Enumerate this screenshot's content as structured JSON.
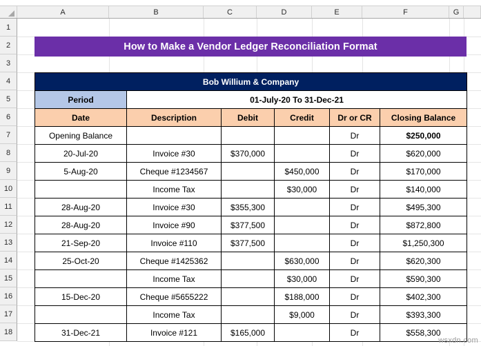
{
  "spreadsheet": {
    "column_headers": [
      "A",
      "B",
      "C",
      "D",
      "E",
      "F",
      "G"
    ],
    "row_headers": [
      "1",
      "2",
      "3",
      "4",
      "5",
      "6",
      "7",
      "8",
      "9",
      "10",
      "11",
      "12",
      "13",
      "14",
      "15",
      "16",
      "17",
      "18"
    ],
    "corner_name": "select-all-corner"
  },
  "title_banner": {
    "text": "How to Make a Vendor Ledger Reconciliation Format",
    "background": "#6B2FA8",
    "text_color": "#FFFFFF"
  },
  "ledger": {
    "company_name": "Bob Willium & Company",
    "company_header_background": "#002060",
    "period_label": "Period",
    "period_label_background": "#B4C7E7",
    "period_value": "01-July-20 To 31-Dec-21",
    "header_background": "#FBCFAD",
    "columns": [
      "Date",
      "Description",
      "Debit",
      "Credit",
      "Dr or CR",
      "Closing Balance"
    ],
    "rows": [
      {
        "date": "Opening Balance",
        "description": "",
        "debit": "",
        "credit": "",
        "dr_or_cr": "Dr",
        "closing_balance": "$250,000",
        "bold_balance": true,
        "date_bold": false
      },
      {
        "date": "20-Jul-20",
        "description": "Invoice #30",
        "debit": "$370,000",
        "credit": "",
        "dr_or_cr": "Dr",
        "closing_balance": "$620,000",
        "bold_balance": false
      },
      {
        "date": "5-Aug-20",
        "description": "Cheque #1234567",
        "debit": "",
        "credit": "$450,000",
        "dr_or_cr": "Dr",
        "closing_balance": "$170,000",
        "bold_balance": false
      },
      {
        "date": "",
        "description": "Income Tax",
        "debit": "",
        "credit": "$30,000",
        "dr_or_cr": "Dr",
        "closing_balance": "$140,000",
        "bold_balance": false
      },
      {
        "date": "28-Aug-20",
        "description": "Invoice #30",
        "debit": "$355,300",
        "credit": "",
        "dr_or_cr": "Dr",
        "closing_balance": "$495,300",
        "bold_balance": false
      },
      {
        "date": "28-Aug-20",
        "description": "Invoice #90",
        "debit": "$377,500",
        "credit": "",
        "dr_or_cr": "Dr",
        "closing_balance": "$872,800",
        "bold_balance": false
      },
      {
        "date": "21-Sep-20",
        "description": "Invoice #110",
        "debit": "$377,500",
        "credit": "",
        "dr_or_cr": "Dr",
        "closing_balance": "$1,250,300",
        "bold_balance": false
      },
      {
        "date": "25-Oct-20",
        "description": "Cheque #1425362",
        "debit": "",
        "credit": "$630,000",
        "dr_or_cr": "Dr",
        "closing_balance": "$620,300",
        "bold_balance": false
      },
      {
        "date": "",
        "description": "Income Tax",
        "debit": "",
        "credit": "$30,000",
        "dr_or_cr": "Dr",
        "closing_balance": "$590,300",
        "bold_balance": false
      },
      {
        "date": "15-Dec-20",
        "description": "Cheque #5655222",
        "debit": "",
        "credit": "$188,000",
        "dr_or_cr": "Dr",
        "closing_balance": "$402,300",
        "bold_balance": false
      },
      {
        "date": "",
        "description": "Income Tax",
        "debit": "",
        "credit": "$9,000",
        "dr_or_cr": "Dr",
        "closing_balance": "$393,300",
        "bold_balance": false
      },
      {
        "date": "31-Dec-21",
        "description": "Invoice #121",
        "debit": "$165,000",
        "credit": "",
        "dr_or_cr": "Dr",
        "closing_balance": "$558,300",
        "bold_balance": false
      }
    ]
  },
  "watermark": {
    "text": "wsxdn.com"
  }
}
